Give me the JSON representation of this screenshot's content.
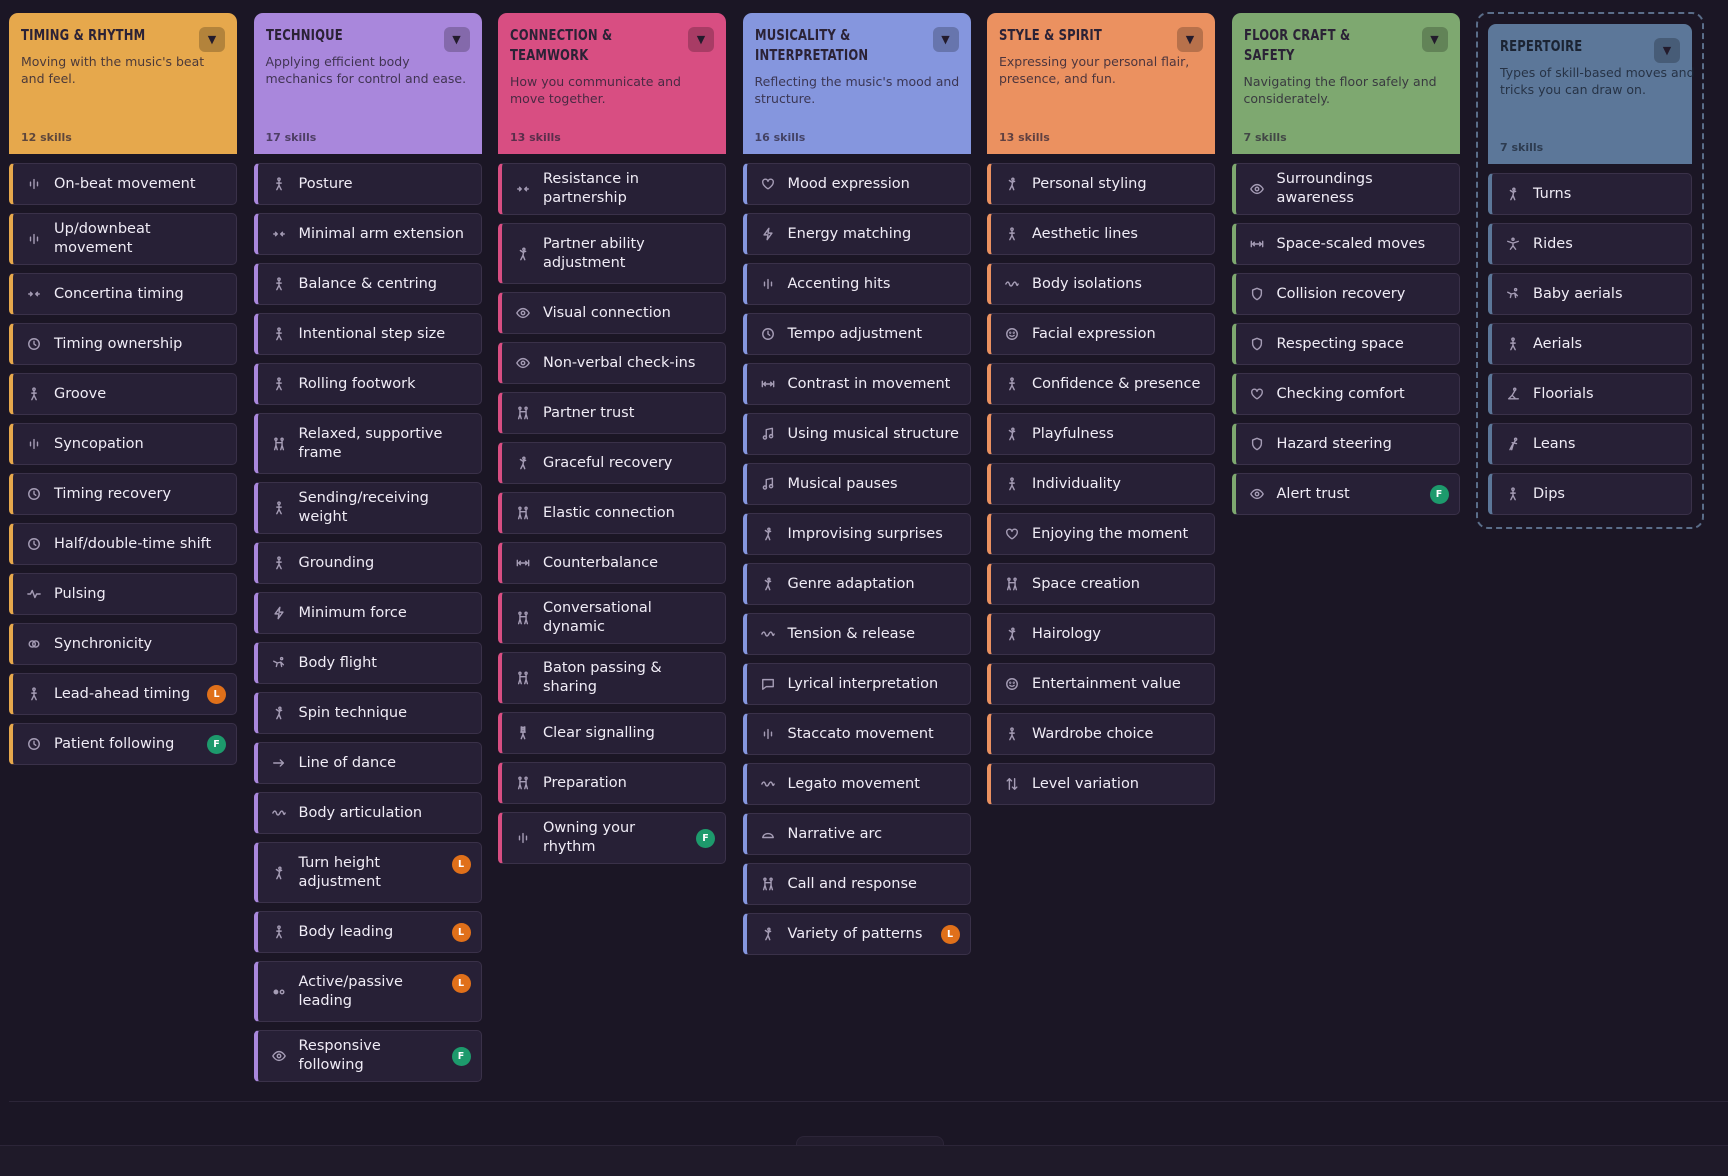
{
  "columns": [
    {
      "key": "timing",
      "title": "Timing & Rhythm",
      "description": "Moving with the music's beat and feel.",
      "count": "12 skills",
      "color": "#e6a84c",
      "items": [
        {
          "label": "On-beat movement",
          "icon": "beat-icon"
        },
        {
          "label": "Up/downbeat movement",
          "icon": "beat-icon"
        },
        {
          "label": "Concertina timing",
          "icon": "compress-icon"
        },
        {
          "label": "Timing ownership",
          "icon": "clock-icon"
        },
        {
          "label": "Groove",
          "icon": "dancer-icon"
        },
        {
          "label": "Syncopation",
          "icon": "beat-icon"
        },
        {
          "label": "Timing recovery",
          "icon": "clock-icon"
        },
        {
          "label": "Half/double-time shift",
          "icon": "clock-icon"
        },
        {
          "label": "Pulsing",
          "icon": "pulse-icon"
        },
        {
          "label": "Synchronicity",
          "icon": "link-icon"
        },
        {
          "label": "Lead-ahead timing",
          "icon": "dancer-icon",
          "badge": "L"
        },
        {
          "label": "Patient following",
          "icon": "clock-icon",
          "badge": "F"
        }
      ]
    },
    {
      "key": "technique",
      "title": "Technique",
      "description": "Applying efficient body mechanics for control and ease.",
      "count": "17 skills",
      "color": "#a987dc",
      "items": [
        {
          "label": "Posture",
          "icon": "dancer-icon"
        },
        {
          "label": "Minimal arm extension",
          "icon": "compress-icon"
        },
        {
          "label": "Balance & centring",
          "icon": "dancer-icon"
        },
        {
          "label": "Intentional step size",
          "icon": "dancer-icon"
        },
        {
          "label": "Rolling footwork",
          "icon": "dancer-icon"
        },
        {
          "label": "Relaxed, supportive frame",
          "icon": "couple-icon",
          "tall": true
        },
        {
          "label": "Sending/receiving weight",
          "icon": "dancer-icon"
        },
        {
          "label": "Grounding",
          "icon": "dancer-icon"
        },
        {
          "label": "Minimum force",
          "icon": "bolt-icon"
        },
        {
          "label": "Body flight",
          "icon": "fly-icon"
        },
        {
          "label": "Spin technique",
          "icon": "spin-icon"
        },
        {
          "label": "Line of dance",
          "icon": "arrow-right-icon"
        },
        {
          "label": "Body articulation",
          "icon": "wave-icon"
        },
        {
          "label": "Turn height adjustment",
          "icon": "spin-icon",
          "badge": "L",
          "tall": true
        },
        {
          "label": "Body leading",
          "icon": "dancer-icon",
          "badge": "L"
        },
        {
          "label": "Active/passive leading",
          "icon": "dots-icon",
          "badge": "L",
          "tall": true
        },
        {
          "label": "Responsive following",
          "icon": "eye-icon",
          "badge": "F"
        }
      ]
    },
    {
      "key": "connection",
      "title": "Connection & Teamwork",
      "description": "How you communicate and move together.",
      "count": "13 skills",
      "color": "#d84e82",
      "items": [
        {
          "label": "Resistance in partnership",
          "icon": "compress-icon"
        },
        {
          "label": "Partner ability adjustment",
          "icon": "spin-icon",
          "tall": true
        },
        {
          "label": "Visual connection",
          "icon": "eye-icon"
        },
        {
          "label": "Non-verbal check-ins",
          "icon": "eye-icon"
        },
        {
          "label": "Partner trust",
          "icon": "couple-icon"
        },
        {
          "label": "Graceful recovery",
          "icon": "spin-icon"
        },
        {
          "label": "Elastic connection",
          "icon": "couple-icon"
        },
        {
          "label": "Counterbalance",
          "icon": "stretch-icon"
        },
        {
          "label": "Conversational dynamic",
          "icon": "couple-icon"
        },
        {
          "label": "Baton passing & sharing",
          "icon": "couple-icon"
        },
        {
          "label": "Clear signalling",
          "icon": "signal-icon"
        },
        {
          "label": "Preparation",
          "icon": "couple-icon"
        },
        {
          "label": "Owning your rhythm",
          "icon": "beat-icon",
          "badge": "F"
        }
      ]
    },
    {
      "key": "musicality",
      "title": "Musicality & Interpretation",
      "description": "Reflecting the music's mood and structure.",
      "count": "16 skills",
      "color": "#8596de",
      "items": [
        {
          "label": "Mood expression",
          "icon": "heart-icon"
        },
        {
          "label": "Energy matching",
          "icon": "bolt-icon"
        },
        {
          "label": "Accenting hits",
          "icon": "beat-icon"
        },
        {
          "label": "Tempo adjustment",
          "icon": "clock-icon"
        },
        {
          "label": "Contrast in movement",
          "icon": "stretch-icon"
        },
        {
          "label": "Using musical structure",
          "icon": "music-icon"
        },
        {
          "label": "Musical pauses",
          "icon": "music-icon"
        },
        {
          "label": "Improvising surprises",
          "icon": "spin-icon"
        },
        {
          "label": "Genre adaptation",
          "icon": "spin-icon"
        },
        {
          "label": "Tension & release",
          "icon": "wave-icon"
        },
        {
          "label": "Lyrical interpretation",
          "icon": "chat-icon"
        },
        {
          "label": "Staccato movement",
          "icon": "beat-icon"
        },
        {
          "label": "Legato movement",
          "icon": "wave-icon"
        },
        {
          "label": "Narrative arc",
          "icon": "arc-icon"
        },
        {
          "label": "Call and response",
          "icon": "couple-icon"
        },
        {
          "label": "Variety of patterns",
          "icon": "spin-icon",
          "badge": "L"
        }
      ]
    },
    {
      "key": "style",
      "title": "Style & Spirit",
      "description": "Expressing your personal flair, presence, and fun.",
      "count": "13 skills",
      "color": "#eb9160",
      "items": [
        {
          "label": "Personal styling",
          "icon": "spin-icon"
        },
        {
          "label": "Aesthetic lines",
          "icon": "dancer-icon"
        },
        {
          "label": "Body isolations",
          "icon": "wave-icon"
        },
        {
          "label": "Facial expression",
          "icon": "smile-icon"
        },
        {
          "label": "Confidence & presence",
          "icon": "dancer-icon"
        },
        {
          "label": "Playfulness",
          "icon": "spin-icon"
        },
        {
          "label": "Individuality",
          "icon": "dancer-icon"
        },
        {
          "label": "Enjoying the moment",
          "icon": "heart-icon"
        },
        {
          "label": "Space creation",
          "icon": "couple-icon"
        },
        {
          "label": "Hairology",
          "icon": "spin-icon"
        },
        {
          "label": "Entertainment value",
          "icon": "smile-icon"
        },
        {
          "label": "Wardrobe choice",
          "icon": "dancer-icon"
        },
        {
          "label": "Level variation",
          "icon": "updown-icon"
        }
      ]
    },
    {
      "key": "floorcraft",
      "title": "Floor Craft & Safety",
      "description": "Navigating the floor safely and considerately.",
      "count": "7 skills",
      "color": "#7ea870",
      "items": [
        {
          "label": "Surroundings awareness",
          "icon": "eye-icon"
        },
        {
          "label": "Space-scaled moves",
          "icon": "stretch-icon"
        },
        {
          "label": "Collision recovery",
          "icon": "shield-icon"
        },
        {
          "label": "Respecting space",
          "icon": "shield-icon"
        },
        {
          "label": "Checking comfort",
          "icon": "heart-icon"
        },
        {
          "label": "Hazard steering",
          "icon": "shield-icon"
        },
        {
          "label": "Alert trust",
          "icon": "eye-icon",
          "badge": "F"
        }
      ]
    },
    {
      "key": "repertoire",
      "title": "Repertoire",
      "description": "Types of skill-based moves and tricks you can draw on.",
      "count": "7 skills",
      "color": "#5c7799",
      "items": [
        {
          "label": "Turns",
          "icon": "spin-icon"
        },
        {
          "label": "Rides",
          "icon": "ride-icon"
        },
        {
          "label": "Baby aerials",
          "icon": "fly-icon"
        },
        {
          "label": "Aerials",
          "icon": "dancer-icon"
        },
        {
          "label": "Floorials",
          "icon": "floor-icon"
        },
        {
          "label": "Leans",
          "icon": "lean-icon"
        },
        {
          "label": "Dips",
          "icon": "dancer-icon"
        }
      ]
    }
  ]
}
